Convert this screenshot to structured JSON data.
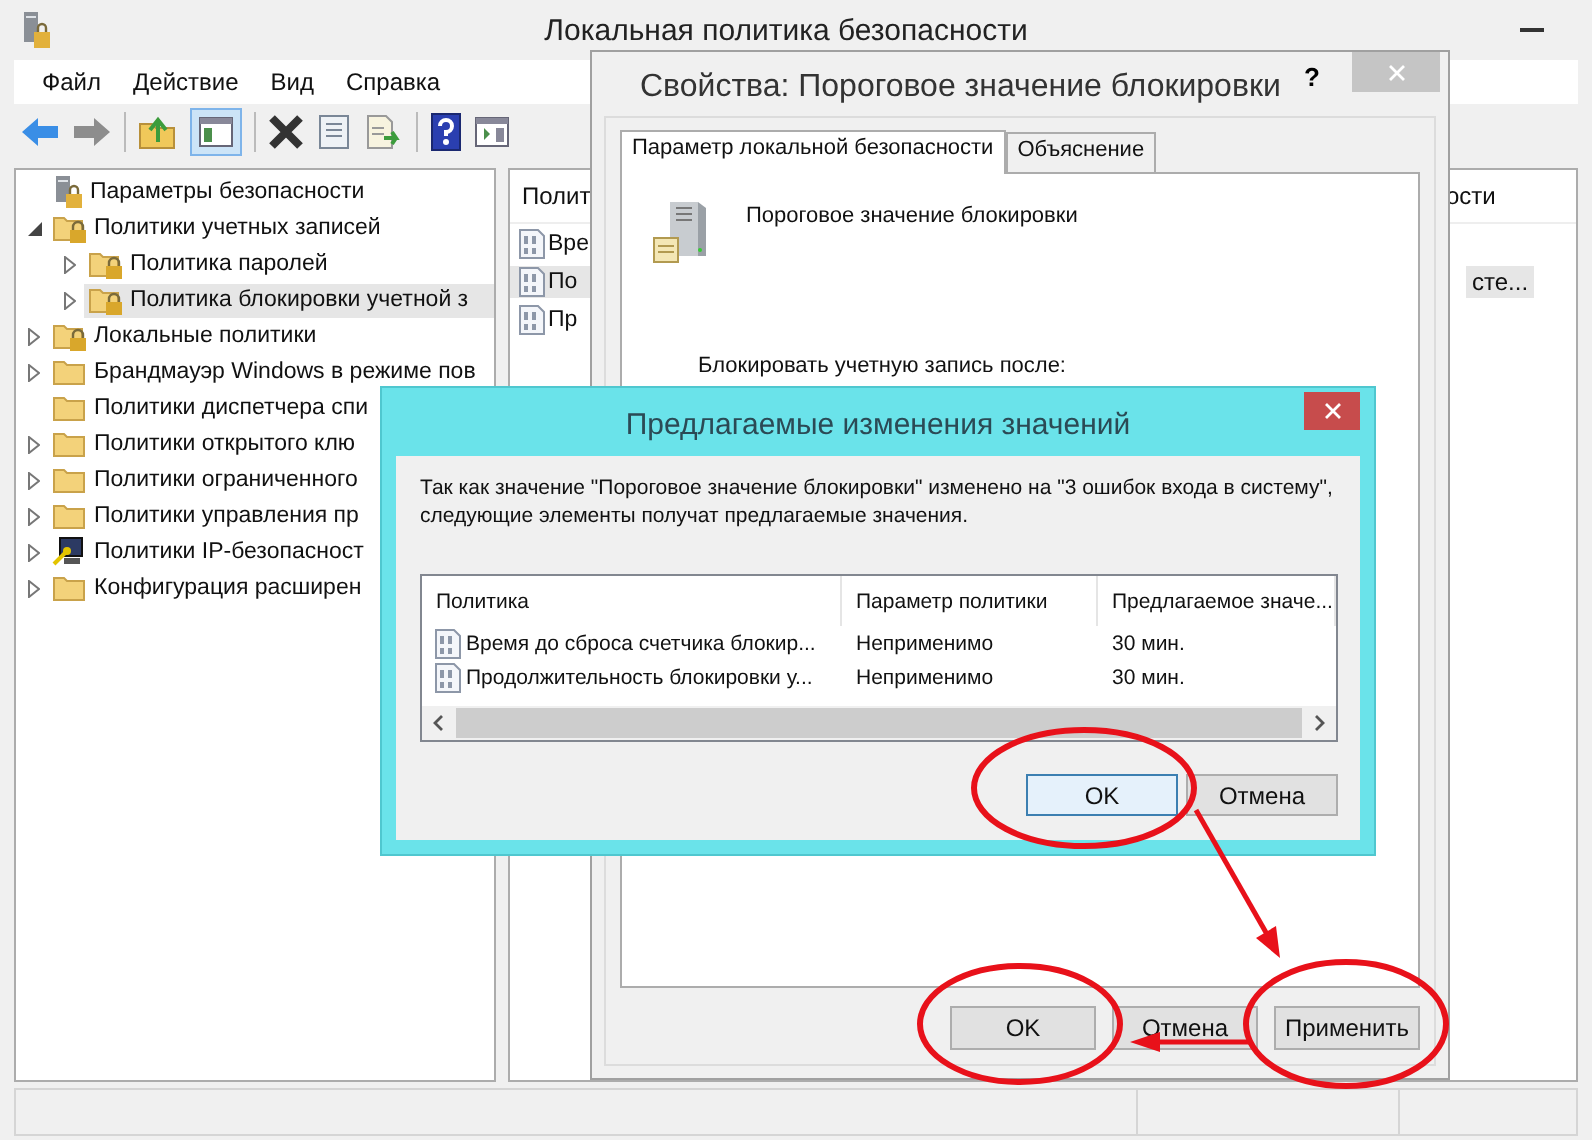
{
  "window": {
    "title": "Локальная политика безопасности"
  },
  "menu": [
    "Файл",
    "Действие",
    "Вид",
    "Справка"
  ],
  "toolbar": {
    "console_tree_shown": true
  },
  "tree": [
    {
      "label": "Параметры безопасности",
      "kind": "root",
      "expandable": false,
      "selected": false,
      "children": [
        {
          "label": "Политики учетных записей",
          "kind": "secured-folder",
          "expandable": true,
          "expanded": true,
          "selected": false,
          "children": [
            {
              "label": "Политика паролей",
              "kind": "secured-folder",
              "expandable": true,
              "expanded": false,
              "selected": false
            },
            {
              "label": "Политика блокировки учетной з",
              "kind": "secured-folder",
              "expandable": true,
              "expanded": false,
              "selected": true
            }
          ]
        },
        {
          "label": "Локальные политики",
          "kind": "secured-folder",
          "expandable": true,
          "expanded": false,
          "selected": false
        },
        {
          "label": "Брандмауэр Windows в режиме пов",
          "kind": "folder",
          "expandable": true,
          "expanded": false,
          "selected": false
        },
        {
          "label": "Политики диспетчера спи",
          "kind": "folder",
          "expandable": false,
          "selected": false
        },
        {
          "label": "Политики открытого клю",
          "kind": "folder",
          "expandable": true,
          "expanded": false,
          "selected": false
        },
        {
          "label": "Политики ограниченного",
          "kind": "folder",
          "expandable": true,
          "expanded": false,
          "selected": false
        },
        {
          "label": "Политики управления пр",
          "kind": "folder",
          "expandable": true,
          "expanded": false,
          "selected": false
        },
        {
          "label": "Политики IP-безопасност",
          "kind": "ip-policy",
          "expandable": true,
          "expanded": false,
          "selected": false
        },
        {
          "label": "Конфигурация расширен",
          "kind": "folder",
          "expandable": true,
          "expanded": false,
          "selected": false
        }
      ]
    }
  ],
  "details": {
    "columns": [
      "Полит",
      "ости"
    ],
    "rows": [
      {
        "policy": "Вре",
        "selected": false
      },
      {
        "policy": "По",
        "setting": "сте...",
        "selected": true
      },
      {
        "policy": "Пр",
        "selected": false
      }
    ]
  },
  "properties_dialog": {
    "title": "Свойства: Пороговое значение блокировки",
    "help": "?",
    "tabs": [
      {
        "label": "Параметр локальной безопасности",
        "selected": true
      },
      {
        "label": "Объяснение",
        "selected": false
      }
    ],
    "policy_name": "Пороговое значение блокировки",
    "prompt": "Блокировать учетную запись после:",
    "buttons": [
      {
        "label": "OK",
        "default": false
      },
      {
        "label": "Отмена",
        "default": false
      },
      {
        "label": "Применить",
        "default": false
      }
    ]
  },
  "suggested_dialog": {
    "title": "Предлагаемые изменения значений",
    "message": "Так как значение \"Пороговое значение блокировки\" изменено на \"3 ошибок входа в систему\", следующие элементы получат предлагаемые значения.",
    "columns": [
      "Политика",
      "Параметр политики",
      "Предлагаемое значе..."
    ],
    "rows": [
      {
        "policy": "Время до сброса счетчика блокир...",
        "setting": "Неприменимо",
        "suggested": "30 мин."
      },
      {
        "policy": "Продолжительность блокировки у...",
        "setting": "Неприменимо",
        "suggested": "30 мин."
      }
    ],
    "buttons": [
      {
        "label": "OK",
        "default": true
      },
      {
        "label": "Отмена",
        "default": false
      }
    ]
  }
}
